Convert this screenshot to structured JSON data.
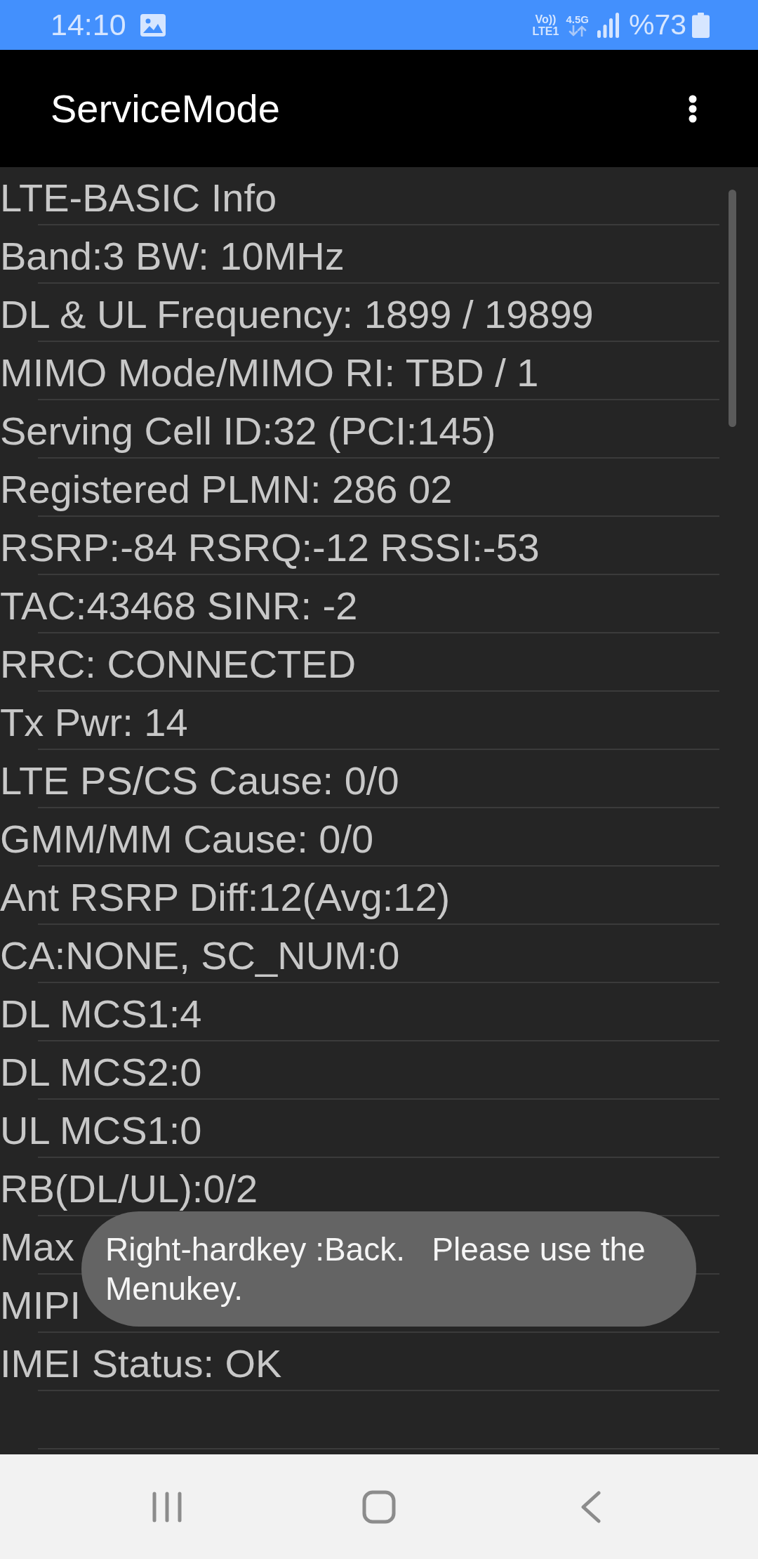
{
  "status_bar": {
    "time": "14:10",
    "volte_top": "Vo))",
    "volte_bottom": "LTE1",
    "network_type": "4.5G",
    "battery_percent": "%73"
  },
  "app_bar": {
    "title": "ServiceMode"
  },
  "info_rows": [
    "LTE-BASIC Info",
    "Band:3 BW: 10MHz",
    "DL & UL Frequency: 1899 / 19899",
    "MIMO Mode/MIMO RI: TBD / 1",
    "Serving Cell ID:32 (PCI:145)",
    "Registered PLMN: 286 02",
    "RSRP:-84 RSRQ:-12 RSSI:-53",
    "TAC:43468 SINR: -2",
    "RRC: CONNECTED",
    "Tx Pwr: 14",
    "LTE PS/CS Cause: 0/0",
    "GMM/MM Cause: 0/0",
    "Ant RSRP Diff:12(Avg:12)",
    "CA:NONE, SC_NUM:0",
    "DL MCS1:4",
    "DL MCS2:0",
    "UL MCS1:0",
    "RB(DL/UL):0/2",
    "Max",
    "MIPI",
    "IMEI Status: OK"
  ],
  "toast": {
    "message": "Right-hardkey :Back.   Please use the Menukey."
  }
}
